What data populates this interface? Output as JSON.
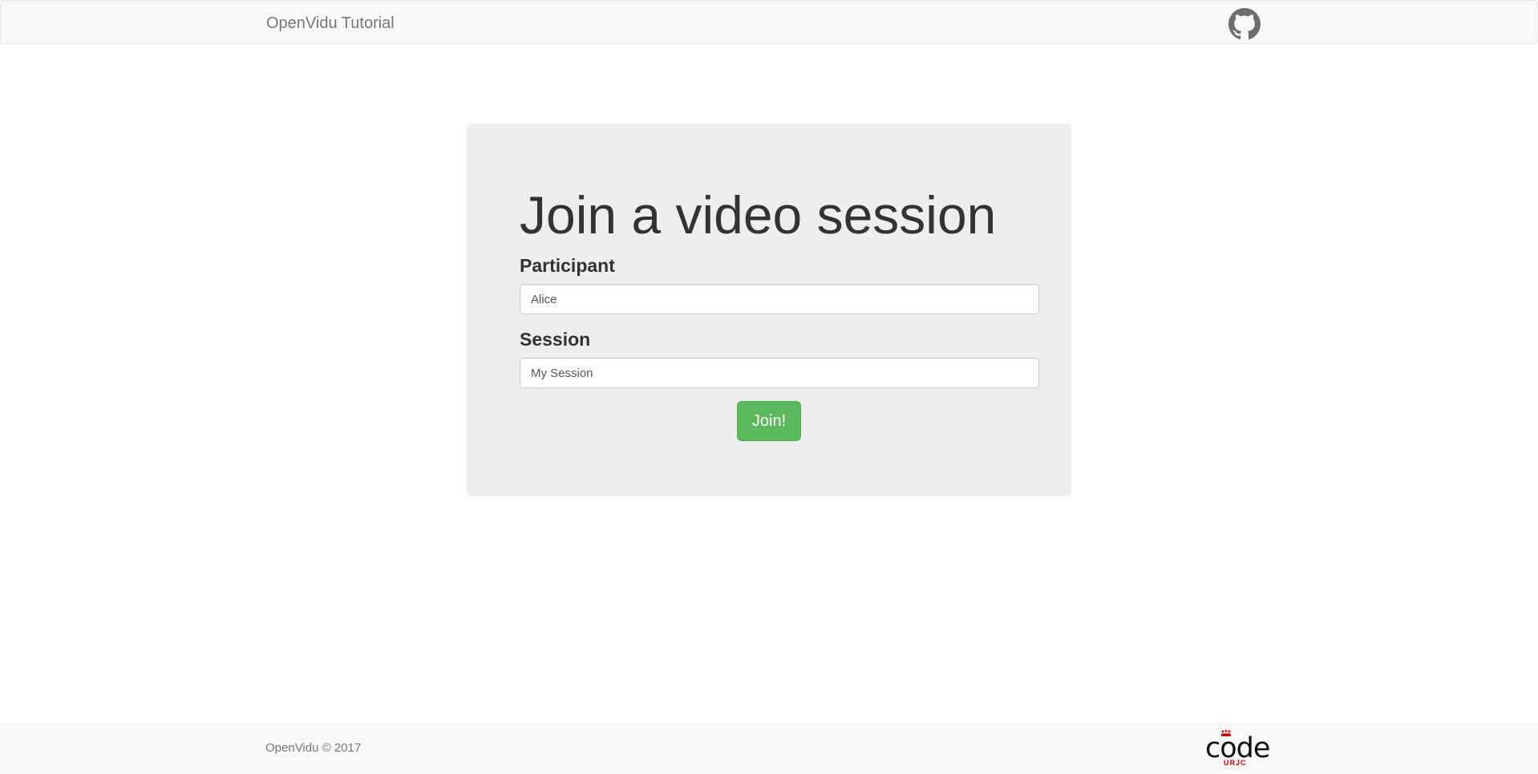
{
  "navbar": {
    "brand": "OpenVidu Tutorial",
    "github_icon": "github-icon"
  },
  "main": {
    "title": "Join a video session",
    "participant_label": "Participant",
    "participant_value": "Alice",
    "session_label": "Session",
    "session_value": "My Session",
    "join_label": "Join!"
  },
  "footer": {
    "copyright": "OpenVidu © 2017",
    "logo_word": "code",
    "logo_sub": "URJC"
  },
  "colors": {
    "navbar_bg": "#f8f8f8",
    "jumbotron_bg": "#eeeeee",
    "join_button": "#5cb85c",
    "logo_accent": "#cc0000"
  }
}
